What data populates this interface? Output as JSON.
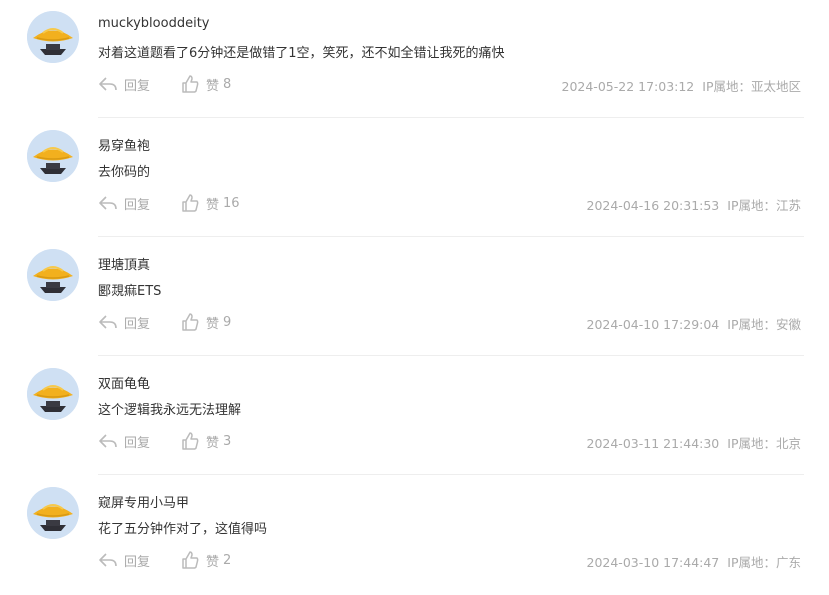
{
  "comments": [
    {
      "username": "muckyblooddeity",
      "content": "对着这道题看了6分钟还是做错了1空，笑死，还不如全错让我死的痛快",
      "reply_label": "回复",
      "like_label": "赞",
      "likes": "8",
      "timestamp": "2024-05-22 17:03:12",
      "ip_label": "IP属地：亚太地区"
    },
    {
      "username": "易穿鱼袍",
      "content": "去你码的",
      "reply_label": "回复",
      "like_label": "赞",
      "likes": "16",
      "timestamp": "2024-04-16 20:31:53",
      "ip_label": "IP属地：江苏"
    },
    {
      "username": "理塘頂真",
      "content": "郾覝痲ETS",
      "reply_label": "回复",
      "like_label": "赞",
      "likes": "9",
      "timestamp": "2024-04-10 17:29:04",
      "ip_label": "IP属地：安徽"
    },
    {
      "username": "双面龟龟",
      "content": "这个逻辑我永远无法理解",
      "reply_label": "回复",
      "like_label": "赞",
      "likes": "3",
      "timestamp": "2024-03-11 21:44:30",
      "ip_label": "IP属地：北京"
    },
    {
      "username": "窥屏专用小马甲",
      "content": "花了五分钟作对了，这值得吗",
      "reply_label": "回复",
      "like_label": "赞",
      "likes": "2",
      "timestamp": "2024-03-10 17:44:47",
      "ip_label": "IP属地：广东"
    }
  ],
  "colors": {
    "avatar_bg": "#cfe0f3",
    "hat": "#f2b01e",
    "hat_shade": "#d99a12",
    "face_shadow": "#2f2f36",
    "meta": "#aaaaaa",
    "divider": "#eeeeee"
  },
  "icons": {
    "avatar": "straw-hat-avatar-icon",
    "reply": "reply-arrow-icon",
    "like": "thumbs-up-icon"
  }
}
